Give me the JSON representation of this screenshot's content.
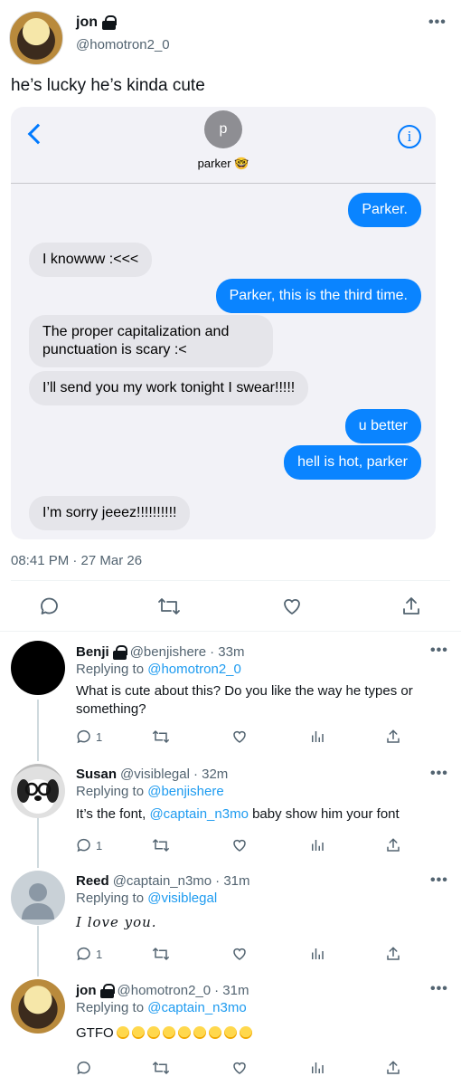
{
  "main_tweet": {
    "name": "jon",
    "handle": "@homotron2_0",
    "text": "he’s lucky he’s kinda cute",
    "timestamp": "08:41 PM · 27 Mar 26",
    "more": "•••"
  },
  "imessage": {
    "contact_initial": "p",
    "contact_name": "parker 🤓",
    "info": "i",
    "messages": [
      {
        "dir": "out",
        "text": "Parker."
      },
      {
        "dir": "in",
        "text": "I knowww :<<<"
      },
      {
        "dir": "out",
        "text": "Parker, this is the third time."
      },
      {
        "dir": "in",
        "text": "The proper capitalization and punctuation is scary :<"
      },
      {
        "dir": "in",
        "text": "I’ll send you my work tonight I swear!!!!!"
      },
      {
        "dir": "out",
        "text": "u better"
      },
      {
        "dir": "out",
        "text": "hell is hot, parker"
      },
      {
        "dir": "in",
        "text": "I’m sorry jeeez!!!!!!!!!!"
      }
    ]
  },
  "replies": [
    {
      "name": "Benji",
      "handle": "@benjishere",
      "time": "· 33m",
      "replying_label": "Replying to",
      "replying_to": "@homotron2_0",
      "text": "What is cute about this? Do you like the way he types or something?",
      "reply_count": "1"
    },
    {
      "name": "Susan",
      "handle": "@visiblegal",
      "time": "· 32m",
      "replying_label": "Replying to",
      "replying_to": "@benjishere",
      "text_before": "It’s the font, ",
      "mention": "@captain_n3mo",
      "text_after": " baby show him your font",
      "reply_count": "1"
    },
    {
      "name": "Reed",
      "handle": "@captain_n3mo",
      "time": "· 31m",
      "replying_label": "Replying to",
      "replying_to": "@visiblegal",
      "text": "I love you.",
      "reply_count": "1"
    },
    {
      "name": "jon",
      "handle": "@homotron2_0",
      "time": "· 31m",
      "replying_label": "Replying to",
      "replying_to": "@captain_n3mo",
      "text": "GTFO",
      "emoji_count": 9
    }
  ],
  "colors": {
    "accent": "#1d9bf0",
    "imessage_blue": "#0a84ff",
    "muted": "#536471"
  }
}
